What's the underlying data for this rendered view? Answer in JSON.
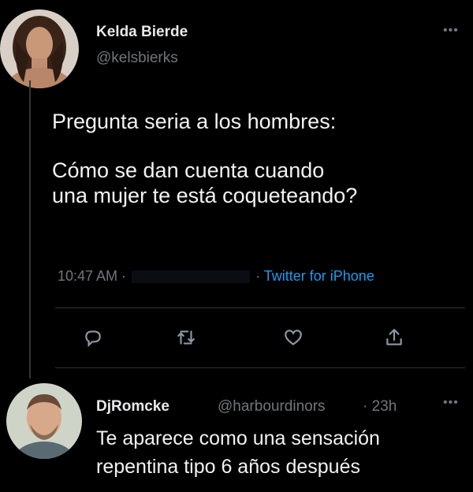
{
  "tweet": {
    "author_name": "Kelda Bierde",
    "author_handle": "@kelsbierks",
    "text_line1": "Pregunta seria a los hombres:",
    "text_line2": "Cómo se dan cuenta cuando",
    "text_line3": "una mujer te está coqueteando?",
    "time": "10:47 AM ·",
    "source_sep": "·",
    "source": "Twitter for iPhone",
    "more_icon": "•••"
  },
  "actions": [
    {
      "icon": "reply-icon"
    },
    {
      "icon": "retweet-icon"
    },
    {
      "icon": "like-icon"
    },
    {
      "icon": "share-icon"
    }
  ],
  "reply": {
    "author_name": "DjRomcke",
    "author_handle": "@harbourdinors",
    "time_ago": "· 23h",
    "text_line1": "Te aparece como una sensación",
    "text_line2": "repentina tipo 6 años después",
    "more_icon": "•••"
  },
  "colors": {
    "background": "#000000",
    "text": "#e7e9ea",
    "muted": "#71767b",
    "accent": "#1d9bf0"
  }
}
